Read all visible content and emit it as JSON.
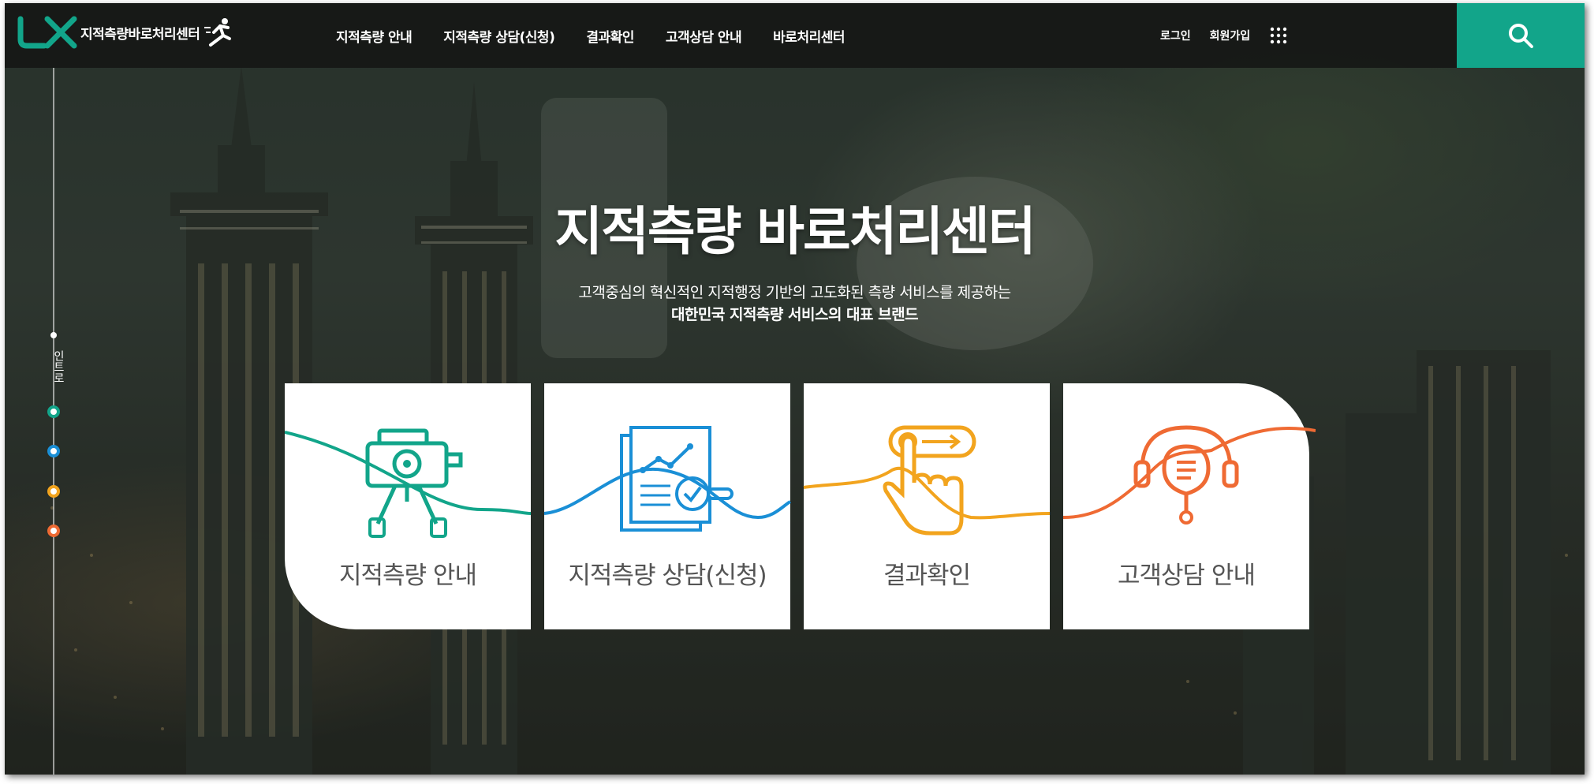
{
  "brand": {
    "logo_mark": "LX",
    "name": "지적측량바로처리센터"
  },
  "nav": {
    "items": [
      "지적측량 안내",
      "지적측량 상담(신청)",
      "결과확인",
      "고객상담 안내",
      "바로처리센터"
    ]
  },
  "utility": {
    "login": "로그인",
    "signup": "회원가입",
    "menu_icon": "grid-icon",
    "search_icon": "search-icon"
  },
  "side": {
    "label": "인트로",
    "dot_colors": [
      "#12a58a",
      "#1a8fd6",
      "#f2a41e",
      "#ef6a33"
    ]
  },
  "hero": {
    "title": "지적측량 바로처리센터",
    "subtitle_line1": "고객중심의 혁신적인 지적행정 기반의 고도화된 측량 서비스를 제공하는",
    "subtitle_line2": "대한민국 지적측량 서비스의 대표 브랜드"
  },
  "cards": [
    {
      "label": "지적측량 안내",
      "icon": "surveying-instrument-icon",
      "color": "#12a58a"
    },
    {
      "label": "지적측량 상담(신청)",
      "icon": "document-chart-icon",
      "color": "#1a8fd6"
    },
    {
      "label": "결과확인",
      "icon": "touch-hand-icon",
      "color": "#f2a41e"
    },
    {
      "label": "고객상담 안내",
      "icon": "headset-chat-icon",
      "color": "#ef6a33"
    }
  ],
  "colors": {
    "accent": "#12a58a",
    "header_bg": "#141614"
  }
}
